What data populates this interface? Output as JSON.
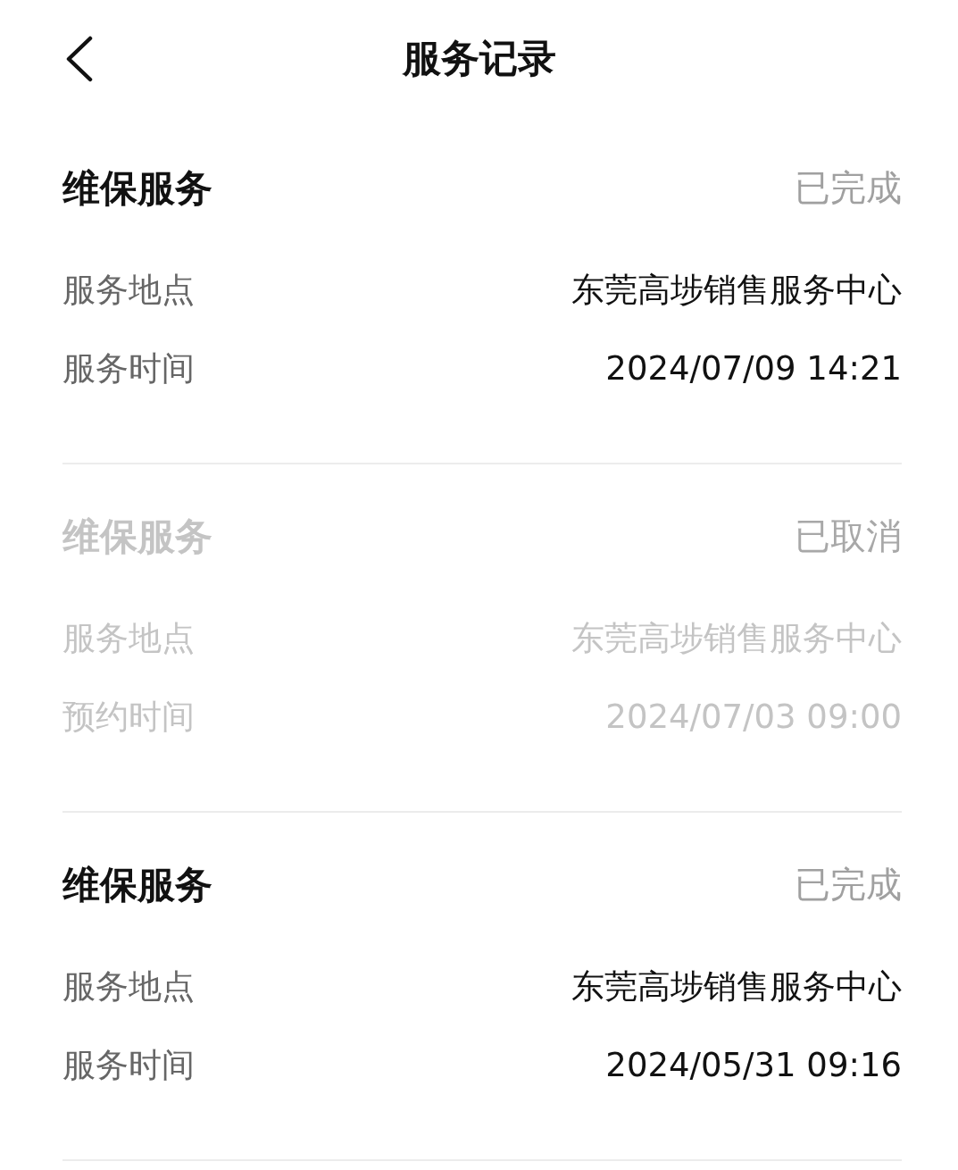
{
  "header": {
    "title": "服务记录"
  },
  "records": [
    {
      "title": "维保服务",
      "status": "已完成",
      "cancelled": false,
      "rows": [
        {
          "label": "服务地点",
          "value": "东莞高埗销售服务中心"
        },
        {
          "label": "服务时间",
          "value": "2024/07/09 14:21"
        }
      ]
    },
    {
      "title": "维保服务",
      "status": "已取消",
      "cancelled": true,
      "rows": [
        {
          "label": "服务地点",
          "value": "东莞高埗销售服务中心"
        },
        {
          "label": "预约时间",
          "value": "2024/07/03 09:00"
        }
      ]
    },
    {
      "title": "维保服务",
      "status": "已完成",
      "cancelled": false,
      "rows": [
        {
          "label": "服务地点",
          "value": "东莞高埗销售服务中心"
        },
        {
          "label": "服务时间",
          "value": "2024/05/31 09:16"
        }
      ]
    }
  ]
}
